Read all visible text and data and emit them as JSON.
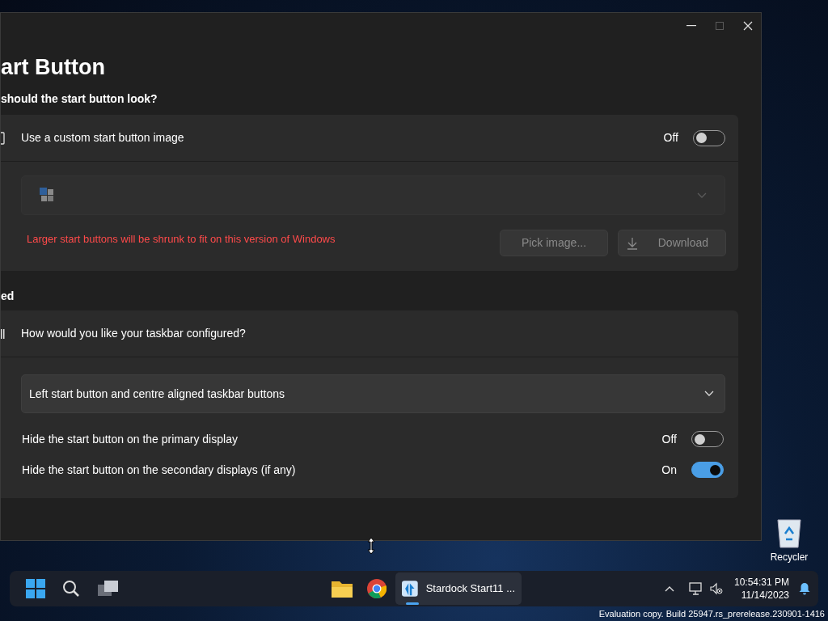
{
  "window": {
    "title": "art Button"
  },
  "sections": [
    {
      "heading": "should the start button look?",
      "setting": {
        "label": "Use a custom start button image",
        "state_text": "Off",
        "on": false
      },
      "image_dropdown": {
        "disabled": true
      },
      "warning": "Larger start buttons will be shrunk to fit on this version of Windows",
      "buttons": [
        {
          "label": "Pick image...",
          "kind": "plain",
          "disabled": true
        },
        {
          "label": "Download",
          "kind": "download",
          "disabled": true
        }
      ]
    },
    {
      "heading": "ed",
      "setting": {
        "label": "How would you like your taskbar configured?"
      },
      "dropdown": {
        "value": "Left start button and centre aligned taskbar buttons"
      },
      "options": [
        {
          "label": "Hide the start button on the primary display",
          "state_text": "Off",
          "on": false
        },
        {
          "label": "Hide the start button on the secondary displays (if any)",
          "state_text": "On",
          "on": true
        }
      ]
    }
  ],
  "desktop": {
    "icons": [
      {
        "label": "Recycler"
      }
    ],
    "watermark": "Evaluation copy. Build 25947.rs_prerelease.230901-1416"
  },
  "taskbar": {
    "window_button": {
      "label": "Stardock Start11 ...",
      "running": true
    },
    "clock": {
      "time": "10:54:31 PM",
      "date": "11/14/2023"
    }
  }
}
